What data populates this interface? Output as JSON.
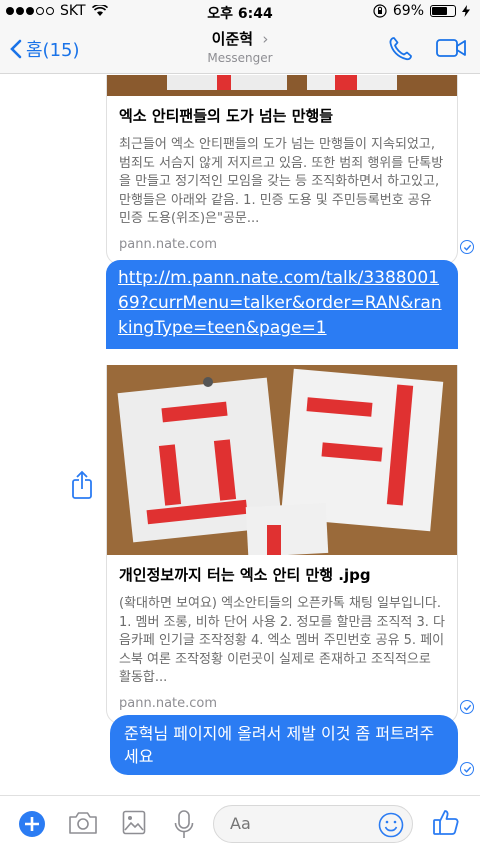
{
  "status_bar": {
    "carrier": "SKT",
    "time": "오후 6:44",
    "battery": "69%",
    "battery_level": 0.69
  },
  "nav": {
    "back_label": "홈(15)",
    "title": "이준혁",
    "title_chevron": "›",
    "subtitle": "Messenger"
  },
  "messages": {
    "card1": {
      "title": "엑소 안티팬들의 도가 넘는 만행들",
      "desc": "최근들어 엑소 안티팬들의 도가 넘는 만행들이 지속되었고, 범죄도 서슴지 않게 저지르고 있음. 또한 범죄 행위를 단톡방을 만들고 정기적인 모임을 갖는 등 조직화하면서 하고있고, 만행들은 아래와 같음. 1. 민증 도용 및 주민등록번호 공유 민증 도용(위조)은\"공문...",
      "source": "pann.nate.com"
    },
    "link": {
      "text": "http://m.pann.nate.com/talk/338800169?currMenu=talker&order=RAN&rankingType=teen&page=1"
    },
    "card2": {
      "title": "개인정보까지 터는 엑소 안티 만행 .jpg",
      "desc": "(확대하면 보여요) 엑소안티들의 오픈카톡 채팅 일부입니다. 1. 멤버 조롱, 비하 단어 사용 2. 정모를 할만큼 조직적 3. 다음카페 인기글 조작정황 4. 엑소 멤버 주민번호 공유 5. 페이스북 여론 조작정황 이런곳이 실제로 존재하고 조직적으로 활동합...",
      "source": "pann.nate.com"
    },
    "text_message": "준혁님 페이지에 올려서 제발 이것 좀 퍼트려주세요"
  },
  "toolbar": {
    "compose_placeholder": "Aa"
  },
  "colors": {
    "accent": "#2b7cf3",
    "nav_bg": "#f7f7f7"
  }
}
